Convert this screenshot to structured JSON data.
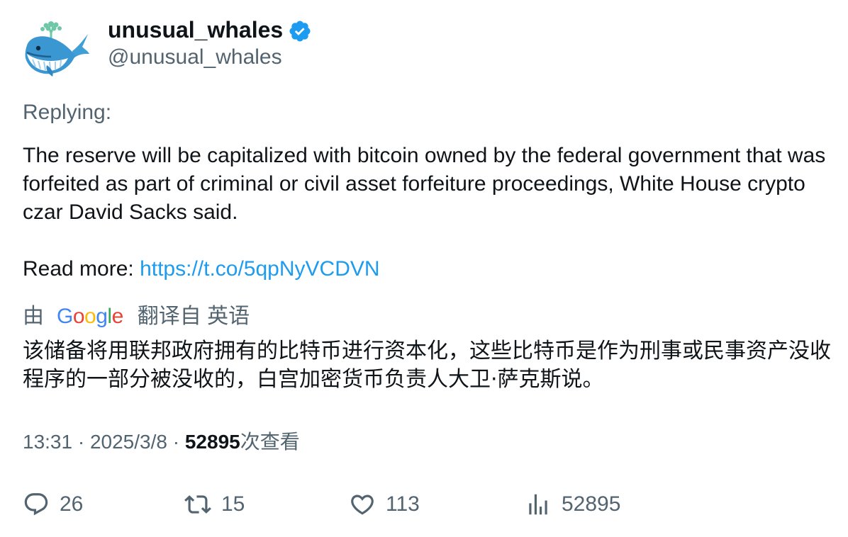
{
  "author": {
    "name": "unusual_whales",
    "handle": "@unusual_whales",
    "verified": true,
    "verified_color": "#1d9bf0"
  },
  "replying": "Replying:",
  "tweet": {
    "text_line1": "The reserve will be capitalized with bitcoin owned by the federal government that was forfeited as part of criminal or civil asset forfeiture proceedings, White House crypto czar David Sacks said.",
    "read_more_label": "Read more: ",
    "link": "https://t.co/5qpNyVCDVN",
    "link_color": "#1d9bf0"
  },
  "translation": {
    "by_label": "由",
    "google_letters": [
      {
        "ch": "G",
        "color": "#4285F4"
      },
      {
        "ch": "o",
        "color": "#EA4335"
      },
      {
        "ch": "o",
        "color": "#FBBC05"
      },
      {
        "ch": "g",
        "color": "#4285F4"
      },
      {
        "ch": "l",
        "color": "#34A853"
      },
      {
        "ch": "e",
        "color": "#EA4335"
      }
    ],
    "from_label": "翻译自 英语",
    "text": "该储备将用联邦政府拥有的比特币进行资本化，这些比特币是作为刑事或民事资产没收程序的一部分被没收的，白宫加密货币负责人大卫·萨克斯说。"
  },
  "meta": {
    "time": "13:31",
    "sep1": " · ",
    "date": "2025/3/8",
    "sep2": " · ",
    "views_count": "52895",
    "views_label": "次查看"
  },
  "actions": {
    "reply_count": "26",
    "retweet_count": "15",
    "like_count": "113",
    "views_count": "52895"
  },
  "icons": {
    "avatar": "whale-icon",
    "verified": "verified-badge-icon",
    "reply": "reply-icon",
    "retweet": "retweet-icon",
    "like": "heart-icon",
    "views": "analytics-icon"
  }
}
